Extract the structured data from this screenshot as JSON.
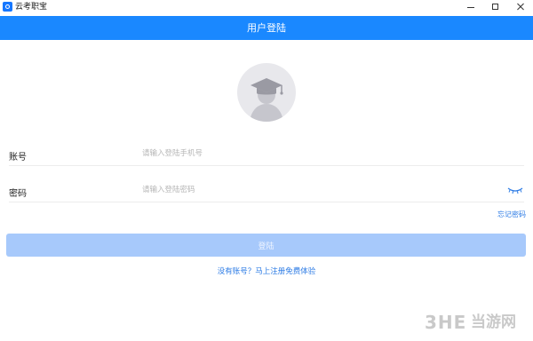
{
  "window": {
    "app_name": "云考职宝",
    "icons": [
      "app-logo-icon",
      "minimize-icon",
      "maximize-icon",
      "close-icon"
    ]
  },
  "header": {
    "title": "用户登陆"
  },
  "avatar": {
    "icon": "graduation-cap-avatar-icon"
  },
  "form": {
    "account": {
      "label": "账号",
      "placeholder": "请输入登陆手机号",
      "value": ""
    },
    "password": {
      "label": "密码",
      "placeholder": "请输入登陆密码",
      "value": ""
    },
    "eye_icon": "eye-closed-icon",
    "forgot_password": "忘记密码",
    "login_button": "登陆",
    "register_link": "没有账号？马上注册免费体验"
  },
  "watermark": {
    "logo": "3HE",
    "text": "当游网"
  },
  "colors": {
    "header_bg": "#1a88ff",
    "button_bg": "#a7c9fb",
    "link": "#2c7be5",
    "avatar_bg": "#e8e8ec"
  }
}
